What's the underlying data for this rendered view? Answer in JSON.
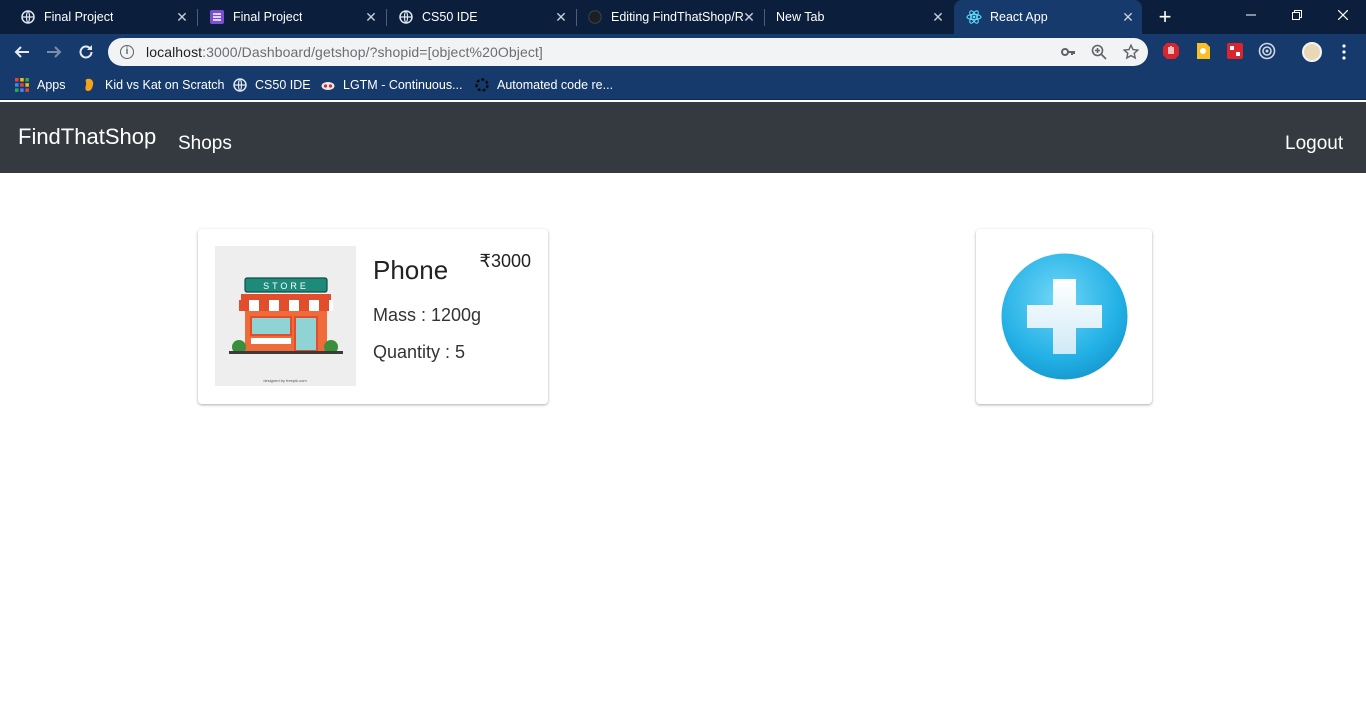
{
  "browser": {
    "tabs": [
      {
        "title": "Final Project",
        "icon": "globe-icon"
      },
      {
        "title": "Final Project",
        "icon": "list-doc-icon"
      },
      {
        "title": "CS50 IDE",
        "icon": "globe-icon"
      },
      {
        "title": "Editing FindThatShop/R",
        "icon": "github-icon"
      },
      {
        "title": "New Tab",
        "icon": ""
      },
      {
        "title": "React App",
        "icon": "react-icon"
      }
    ],
    "tab_close_glyph": "✕",
    "new_tab_glyph": "+",
    "url_host": "localhost",
    "url_rest": ":3000/Dashboard/getshop/?shopid=[object%20Object]",
    "bookmarks": [
      {
        "label": "Apps",
        "icon": "apps-grid-icon"
      },
      {
        "label": "Kid vs Kat on Scratch",
        "icon": "scratch-icon"
      },
      {
        "label": "CS50 IDE",
        "icon": "globe-icon"
      },
      {
        "label": "LGTM - Continuous...",
        "icon": "lgtm-icon"
      },
      {
        "label": "Automated code re...",
        "icon": "spinner-icon"
      }
    ]
  },
  "app": {
    "brand": "FindThatShop",
    "nav_shops": "Shops",
    "nav_logout": "Logout"
  },
  "product": {
    "name": "Phone",
    "price": "₹3000",
    "mass_label": "Mass : ",
    "mass_value": "1200g",
    "quantity_label": "Quantity : ",
    "quantity_value": "5",
    "image_sign": "STORE",
    "image_caption": "designed by freepik.com"
  },
  "colors": {
    "tabstrip": "#0b1f3d",
    "toolbar": "#163a6b",
    "navbar": "#343a40",
    "add_button": "#29b6e8"
  }
}
